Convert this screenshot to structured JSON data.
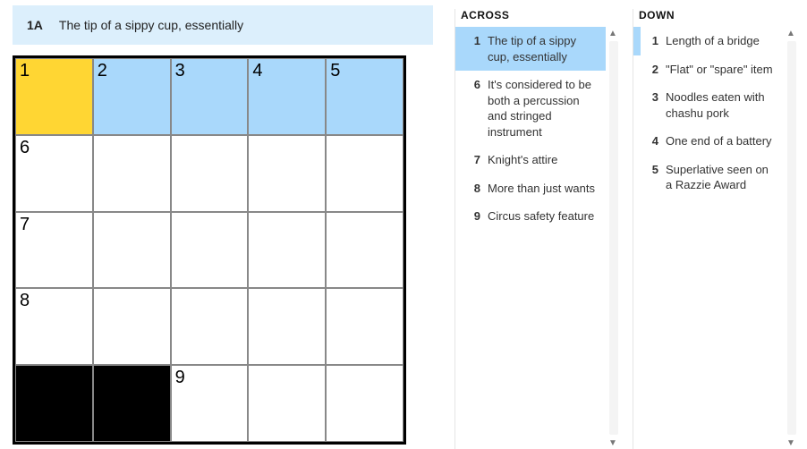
{
  "current_clue": {
    "id": "1A",
    "text": "The tip of a sippy cup, essentially"
  },
  "grid": {
    "rows": 5,
    "cols": 5,
    "cells": [
      [
        {
          "n": "1",
          "s": "cur"
        },
        {
          "n": "2",
          "s": "hl"
        },
        {
          "n": "3",
          "s": "hl"
        },
        {
          "n": "4",
          "s": "hl"
        },
        {
          "n": "5",
          "s": "hl"
        }
      ],
      [
        {
          "n": "6"
        },
        {},
        {},
        {},
        {}
      ],
      [
        {
          "n": "7"
        },
        {},
        {},
        {},
        {}
      ],
      [
        {
          "n": "8"
        },
        {},
        {},
        {},
        {}
      ],
      [
        {
          "s": "black"
        },
        {
          "s": "black"
        },
        {
          "n": "9"
        },
        {},
        {}
      ]
    ]
  },
  "across": {
    "title": "ACROSS",
    "items": [
      {
        "n": "1",
        "t": "The tip of a sippy cup, essentially",
        "sel": true
      },
      {
        "n": "6",
        "t": "It's considered to be both a percussion and stringed instrument"
      },
      {
        "n": "7",
        "t": "Knight's attire"
      },
      {
        "n": "8",
        "t": "More than just wants"
      },
      {
        "n": "9",
        "t": "Circus safety feature"
      }
    ]
  },
  "down": {
    "title": "DOWN",
    "items": [
      {
        "n": "1",
        "t": "Length of a bridge",
        "rel": true
      },
      {
        "n": "2",
        "t": "\"Flat\" or \"spare\" item"
      },
      {
        "n": "3",
        "t": "Noodles eaten with chashu pork"
      },
      {
        "n": "4",
        "t": "One end of a battery"
      },
      {
        "n": "5",
        "t": "Superlative seen on a Razzie Award"
      }
    ]
  }
}
